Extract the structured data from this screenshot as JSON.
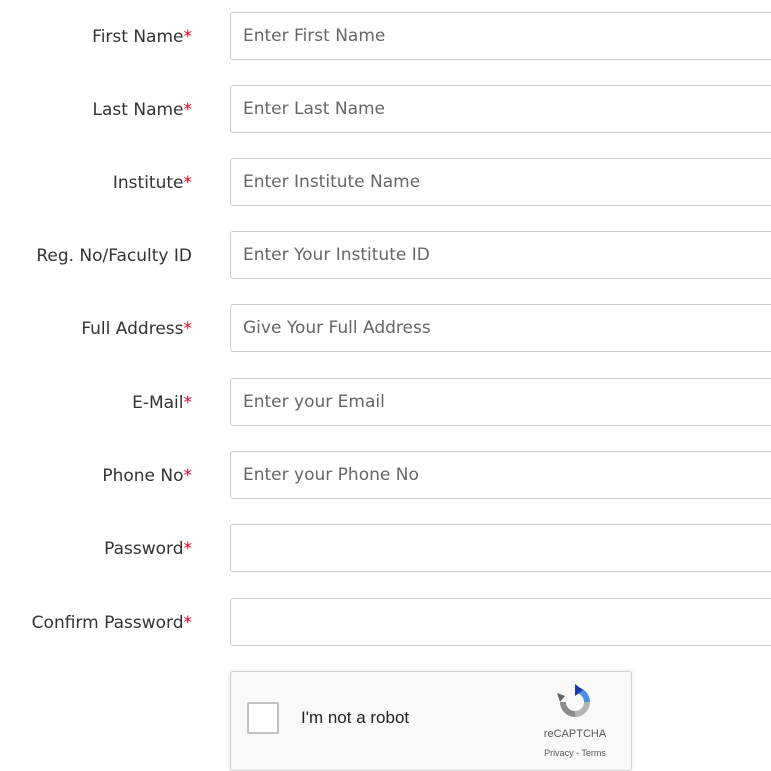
{
  "form": {
    "fields": [
      {
        "label": "First Name",
        "required_mark": "*",
        "placeholder": "Enter First Name",
        "value": "",
        "type": "text"
      },
      {
        "label": "Last Name",
        "required_mark": "*",
        "placeholder": "Enter Last Name",
        "value": "",
        "type": "text"
      },
      {
        "label": "Institute",
        "required_mark": "*",
        "placeholder": "Enter Institute Name",
        "value": "",
        "type": "text"
      },
      {
        "label": "Reg. No/Faculty ID",
        "required_mark": "",
        "placeholder": "Enter Your Institute ID",
        "value": "",
        "type": "text"
      },
      {
        "label": "Full Address",
        "required_mark": "*",
        "placeholder": "Give Your Full Address",
        "value": "",
        "type": "text"
      },
      {
        "label": "E-Mail",
        "required_mark": "*",
        "placeholder": "Enter your Email",
        "value": "",
        "type": "text"
      },
      {
        "label": "Phone No",
        "required_mark": "*",
        "placeholder": "Enter your Phone No",
        "value": "",
        "type": "text"
      },
      {
        "label": "Password",
        "required_mark": "*",
        "placeholder": "",
        "value": "",
        "type": "password"
      },
      {
        "label": "Confirm Password",
        "required_mark": "*",
        "placeholder": "",
        "value": "",
        "type": "password"
      }
    ]
  },
  "captcha": {
    "checkbox_label": "I'm not a robot",
    "brand": "reCAPTCHA",
    "privacy": "Privacy",
    "separator": " - ",
    "terms": "Terms",
    "logo_icon": "recaptcha-logo-icon"
  },
  "colors": {
    "required": "#e0001b",
    "label": "#333333",
    "input_border": "#cccccc",
    "placeholder": "#666666"
  }
}
